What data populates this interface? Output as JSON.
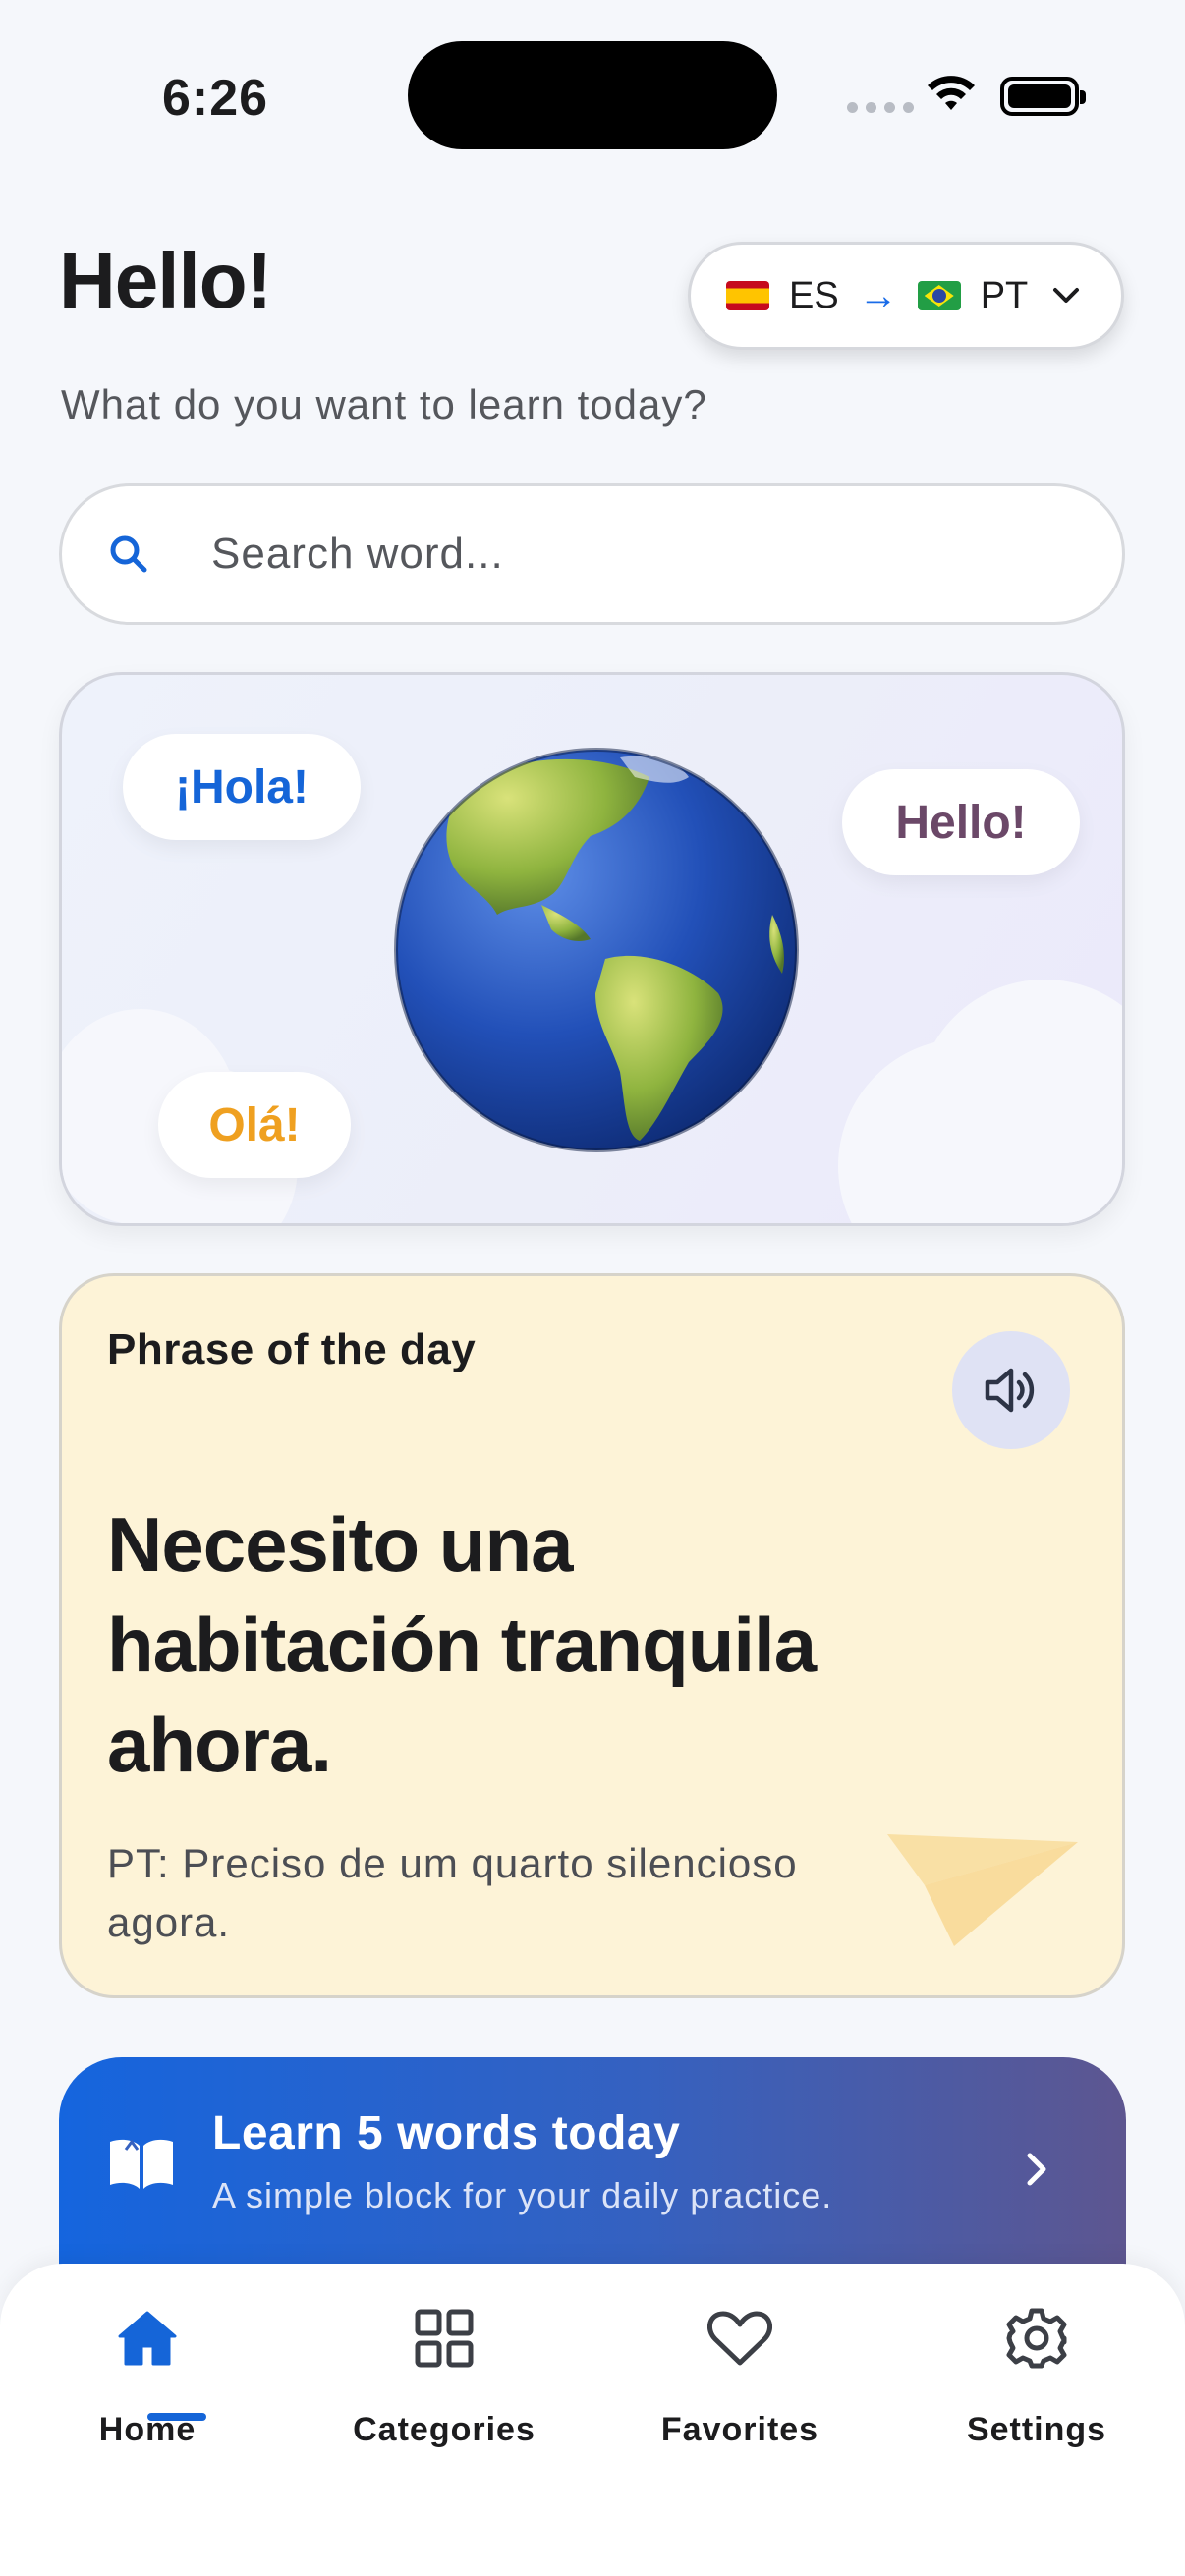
{
  "status_bar": {
    "time": "6:26"
  },
  "header": {
    "greeting": "Hello!",
    "subtitle": "What do you want to learn today?",
    "language_selector": {
      "source_code": "ES",
      "target_code": "PT",
      "source_flag": "spain-flag",
      "target_flag": "brazil-flag",
      "arrow_icon": "arrow-right-icon",
      "dropdown_icon": "chevron-down-icon"
    }
  },
  "search": {
    "placeholder": "Search word...",
    "value": ""
  },
  "hero": {
    "bubble_es": "¡Hola!",
    "bubble_en": "Hello!",
    "bubble_pt": "Olá!",
    "image": "globe-americas"
  },
  "phrase_of_day": {
    "label": "Phrase of the day",
    "phrase": "Necesito una habitación tranquila ahora.",
    "translation": "PT: Preciso de um quarto silencioso agora."
  },
  "learn_card": {
    "title": "Learn 5 words today",
    "subtitle": "A simple block for your daily practice."
  },
  "tabs": [
    {
      "label": "Home",
      "icon": "home-icon",
      "active": true
    },
    {
      "label": "Categories",
      "icon": "grid-icon",
      "active": false
    },
    {
      "label": "Favorites",
      "icon": "heart-icon",
      "active": false
    },
    {
      "label": "Settings",
      "icon": "gear-icon",
      "active": false
    }
  ],
  "colors": {
    "accent": "#1565d8",
    "background": "#f5f7fb",
    "phrase_card": "#fdf3d7",
    "hola": "#1565d8",
    "hello": "#6b4868",
    "ola": "#efa020"
  }
}
